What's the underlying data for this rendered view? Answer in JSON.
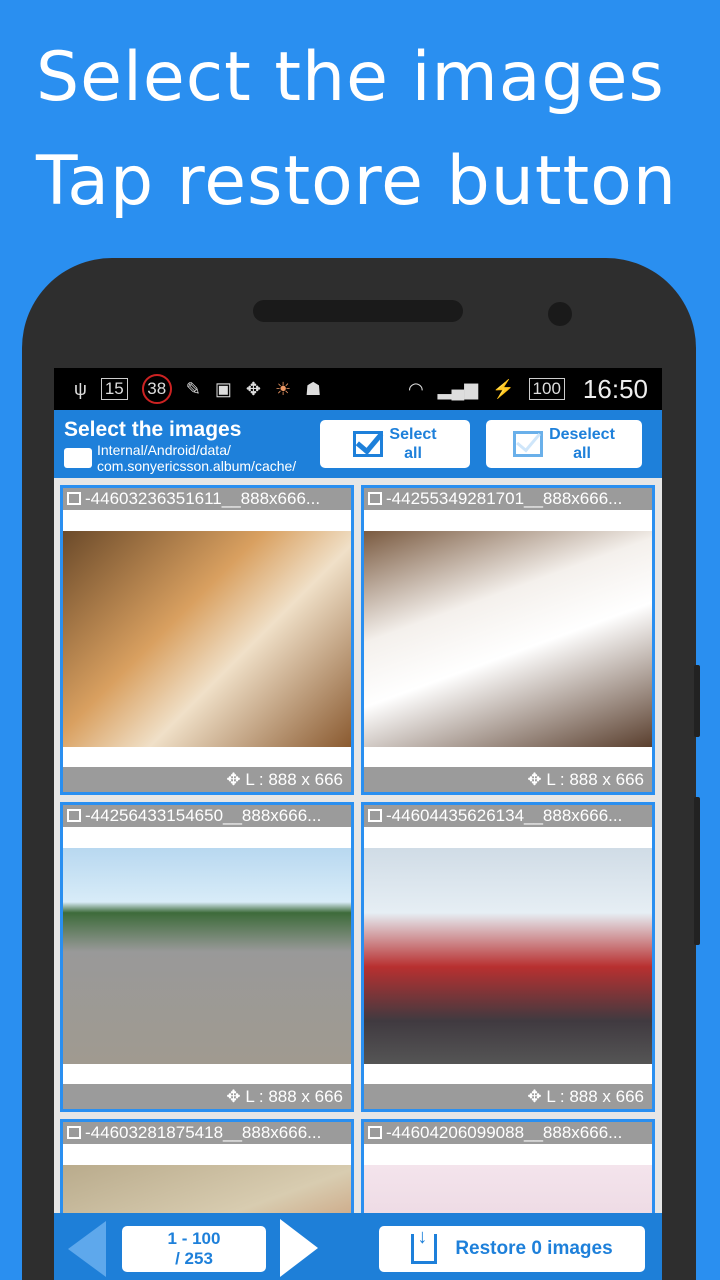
{
  "promo": {
    "line1": "Select the images",
    "line2": "Tap restore button"
  },
  "status_bar": {
    "notif_15": "15",
    "notif_38": "38",
    "battery": "100",
    "time": "16:50"
  },
  "header": {
    "title": "Select the images",
    "path_line1": "Internal/Android/data/",
    "path_line2": "com.sonyericsson.album/cache/",
    "select_all": [
      "Select",
      "all"
    ],
    "deselect_all": [
      "Deselect",
      "all"
    ]
  },
  "images": [
    {
      "name": "-44603236351611__888x666...",
      "size": "L : 888 x 666"
    },
    {
      "name": "-44255349281701__888x666...",
      "size": "L : 888 x 666"
    },
    {
      "name": "-44256433154650__888x666...",
      "size": "L : 888 x 666"
    },
    {
      "name": "-44604435626134__888x666...",
      "size": "L : 888 x 666"
    },
    {
      "name": "-44603281875418__888x666...",
      "size": ""
    },
    {
      "name": "-44604206099088__888x666...",
      "size": ""
    }
  ],
  "bottom": {
    "page_range": "1 - 100",
    "page_total": "/ 253",
    "restore_label": "Restore 0 images"
  },
  "colors": {
    "background": "#2a8ff0",
    "header": "#1e80da",
    "accent": "#1e80da"
  }
}
